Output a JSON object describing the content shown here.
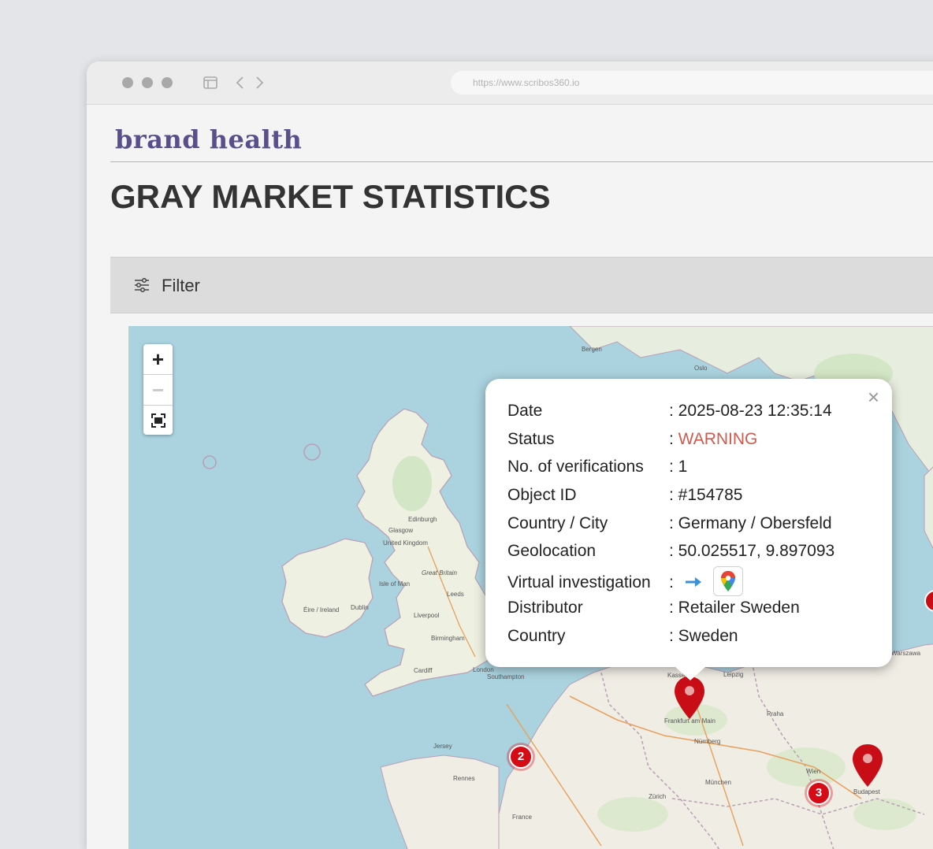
{
  "browser": {
    "url": "https://www.scribos360.io"
  },
  "header": {
    "brand": "brand health",
    "title": "GRAY MARKET STATISTICS"
  },
  "filter": {
    "label": "Filter"
  },
  "map": {
    "zoom_in_label": "+",
    "zoom_out_label": "−",
    "clusters": [
      {
        "count": "2"
      },
      {
        "count": "3"
      }
    ],
    "labels": [
      {
        "text": "Bergen"
      },
      {
        "text": "Oslo"
      },
      {
        "text": "Edinburgh"
      },
      {
        "text": "Glasgow"
      },
      {
        "text": "United Kingdom"
      },
      {
        "text": "Great Britain"
      },
      {
        "text": "Isle of Man"
      },
      {
        "text": "Éire / Ireland"
      },
      {
        "text": "Dublin"
      },
      {
        "text": "Leeds"
      },
      {
        "text": "Liverpool"
      },
      {
        "text": "Birmingham"
      },
      {
        "text": "Cardiff"
      },
      {
        "text": "London"
      },
      {
        "text": "Southampton"
      },
      {
        "text": "Jersey"
      },
      {
        "text": "Rennes"
      },
      {
        "text": "France"
      },
      {
        "text": "Frankfurt am Main"
      },
      {
        "text": "Leipzig"
      },
      {
        "text": "Nürnberg"
      },
      {
        "text": "München"
      },
      {
        "text": "Zürich"
      },
      {
        "text": "Praha"
      },
      {
        "text": "Wien"
      },
      {
        "text": "Budapest"
      },
      {
        "text": "Warszawa"
      },
      {
        "text": "Kassel"
      }
    ]
  },
  "popup": {
    "close_label": "×",
    "rows": [
      {
        "label": "Date",
        "value": ": 2025-08-23 12:35:14"
      },
      {
        "label": "Status",
        "value": "WARNING"
      },
      {
        "label": "No. of verifications",
        "value": ": 1"
      },
      {
        "label": "Object ID",
        "value": ": #154785"
      },
      {
        "label": "Country / City",
        "value": ": Germany / Obersfeld"
      },
      {
        "label": "Geolocation",
        "value": ": 50.025517, 9.897093"
      },
      {
        "label": "Virtual investigation",
        "value": ":"
      },
      {
        "label": "Distributor",
        "value": ": Retailer Sweden"
      },
      {
        "label": "Country",
        "value": ": Sweden"
      }
    ],
    "status_prefix": ": "
  },
  "colors": {
    "brand": "#5a4f8c",
    "warning": "#d15a4e",
    "marker": "#d50b16",
    "sea": "#aad3df",
    "land": "#f2efe9"
  },
  "icons": [
    "window-sidebar-icon",
    "back-arrow-icon",
    "forward-arrow-icon",
    "filter-sliders-icon",
    "fullscreen-icon",
    "close-icon",
    "arrow-right-icon",
    "google-maps-icon",
    "map-pin-icon"
  ]
}
